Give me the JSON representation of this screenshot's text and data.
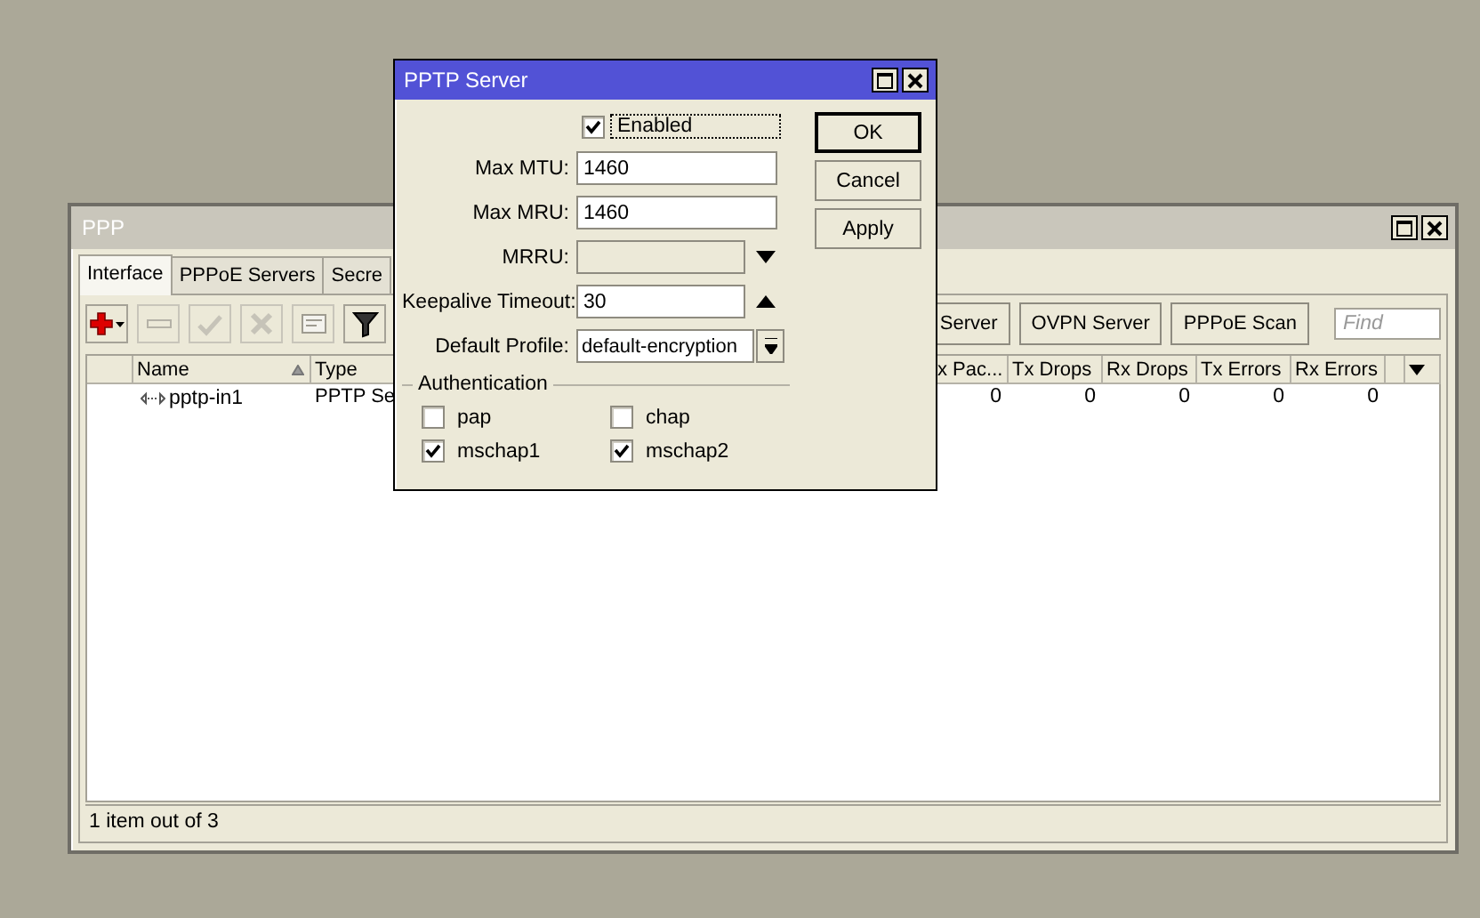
{
  "ppp_window": {
    "title": "PPP",
    "tabs": [
      {
        "label": "Interface",
        "selected": true
      },
      {
        "label": "PPPoE Servers",
        "selected": false
      },
      {
        "label": "Secre",
        "selected": false
      }
    ],
    "tools": [
      {
        "kind": "add",
        "disabled": false
      },
      {
        "kind": "remove",
        "disabled": true
      },
      {
        "kind": "enable",
        "disabled": true
      },
      {
        "kind": "disable",
        "disabled": true
      },
      {
        "kind": "comment",
        "disabled": true
      },
      {
        "kind": "filter",
        "disabled": false
      }
    ],
    "buttons": [
      "Server",
      "OVPN Server",
      "PPPoE Scan"
    ],
    "search": {
      "placeholder": "Find"
    },
    "table": {
      "columns": [
        {
          "label": "Name",
          "sorted": true
        },
        {
          "label": "Type",
          "sorted": false
        },
        {
          "label": "x Pac...",
          "sorted": false
        },
        {
          "label": "Tx Drops",
          "sorted": false
        },
        {
          "label": "Rx Drops",
          "sorted": false
        },
        {
          "label": "Tx Errors",
          "sorted": false
        },
        {
          "label": "Rx Errors",
          "sorted": false
        }
      ],
      "rows": [
        {
          "name": "pptp-in1",
          "type": "PPTP Se",
          "values": [
            "0",
            "0",
            "0",
            "0",
            "0"
          ]
        }
      ]
    },
    "status_bar": "1 item out of 3"
  },
  "dialog": {
    "title": "PPTP Server",
    "enabled": {
      "label": "Enabled",
      "checked": true
    },
    "fields": [
      {
        "kind": "text",
        "label": "Max MTU:",
        "value": "1460"
      },
      {
        "kind": "text",
        "label": "Max MRU:",
        "value": "1460"
      },
      {
        "kind": "expand",
        "label": "MRRU:",
        "disabled": true
      },
      {
        "kind": "collapse",
        "label": "Keepalive Timeout:",
        "value": "30"
      },
      {
        "kind": "select",
        "label": "Default Profile:",
        "value": "default-encryption"
      }
    ],
    "section": "Authentication",
    "auth": [
      {
        "label": "pap",
        "checked": false
      },
      {
        "label": "chap",
        "checked": false
      },
      {
        "label": "mschap1",
        "checked": true
      },
      {
        "label": "mschap2",
        "checked": true
      }
    ],
    "buttons": [
      "OK",
      "Cancel",
      "Apply"
    ]
  }
}
